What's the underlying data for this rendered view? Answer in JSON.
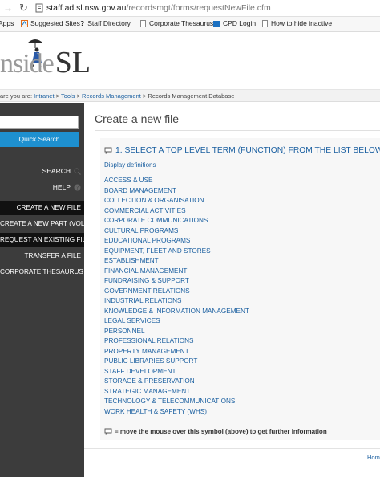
{
  "browser": {
    "url_host": "staff.ad.sl.nsw.gov.au",
    "url_path": "/recordsmgt/forms/requestNewFile.cfm"
  },
  "bookmarks": [
    {
      "label": "Apps",
      "icon": "apps-icon"
    },
    {
      "label": "Suggested Sites",
      "icon": "suggested-sites-icon"
    },
    {
      "label": "Staff Directory",
      "icon": "question-mark-icon"
    },
    {
      "label": "Corporate Thesaurus",
      "icon": "document-icon"
    },
    {
      "label": "CPD Login",
      "icon": "cpd-icon"
    },
    {
      "label": "How to hide inactive",
      "icon": "document-icon"
    }
  ],
  "logo": {
    "part1": "nside",
    "part2": "SL"
  },
  "breadcrumb": {
    "prefix": "are you are: ",
    "items": [
      "Intranet",
      "Tools",
      "Records Management"
    ],
    "current": "Records Management Database",
    "separator": " > "
  },
  "sidebar": {
    "search_value": "",
    "quick_search_label": "Quick Search",
    "search_label": "SEARCH",
    "help_label": "HELP",
    "items": [
      {
        "label": "CREATE A NEW FILE",
        "dark": true
      },
      {
        "label": "CREATE A NEW PART (VOL)",
        "dark": false
      },
      {
        "label": "REQUEST AN EXISTING FILE",
        "dark": true
      },
      {
        "label": "TRANSFER A FILE",
        "dark": false
      },
      {
        "label": "CORPORATE THESAURUS",
        "dark": false
      }
    ]
  },
  "main": {
    "title": "Create a new file",
    "step_heading": "1. SELECT A TOP LEVEL TERM (FUNCTION) FROM THE LIST BELOW",
    "definitions_link": "Display definitions",
    "terms": [
      "ACCESS & USE",
      "BOARD MANAGEMENT",
      "COLLECTION & ORGANISATION",
      "COMMERCIAL ACTIVITIES",
      "CORPORATE COMMUNICATIONS",
      "CULTURAL PROGRAMS",
      "EDUCATIONAL PROGRAMS",
      "EQUIPMENT, FLEET AND STORES",
      "ESTABLISHMENT",
      "FINANCIAL MANAGEMENT",
      "FUNDRAISING & SUPPORT",
      "GOVERNMENT RELATIONS",
      "INDUSTRIAL RELATIONS",
      "KNOWLEDGE & INFORMATION MANAGEMENT",
      "LEGAL SERVICES",
      "PERSONNEL",
      "PROFESSIONAL RELATIONS",
      "PROPERTY MANAGEMENT",
      "PUBLIC LIBRARIES SUPPORT",
      "STAFF DEVELOPMENT",
      "STORAGE & PRESERVATION",
      "STRATEGIC MANAGEMENT",
      "TECHNOLOGY & TELECOMMUNICATIONS",
      "WORK HEALTH & SAFETY (WHS)"
    ],
    "footnote": "= move the mouse over this symbol (above) to get further information"
  },
  "footer": {
    "home_label": "Hom"
  },
  "colors": {
    "link": "#1a5fa0",
    "sidebar_bg": "#3c3c3c",
    "sidebar_dark": "#111111",
    "quick_search_bg": "#1e90d0"
  }
}
